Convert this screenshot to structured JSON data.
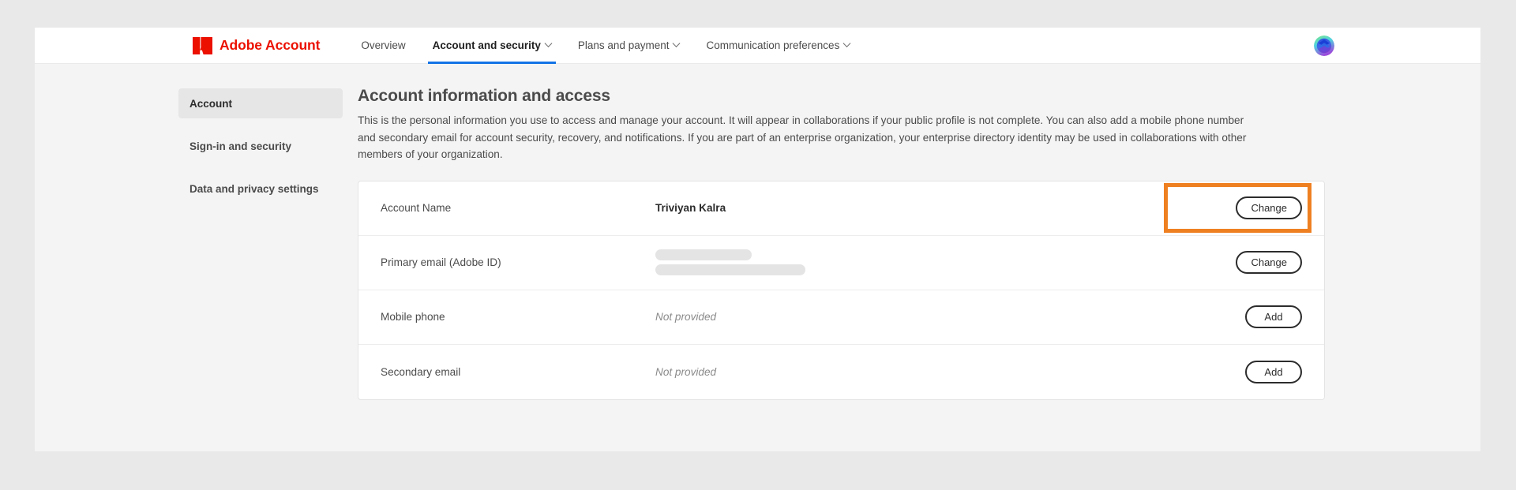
{
  "theme": {
    "page_background": "#e9e9e9",
    "frame_background": "#f4f4f4",
    "nav_background": "#ffffff",
    "brand_red": "#eb1000",
    "active_tab_underline": "#1473e6",
    "highlight_orange": "#ef8022",
    "card_background": "#ffffff",
    "sidebar_selected": "#e6e6e6",
    "redaction_gray": "#e4e4e4"
  },
  "header": {
    "brand": {
      "logo_icon": "adobe-a-logo-icon",
      "title": "Adobe Account"
    },
    "nav_items": [
      {
        "label": "Overview",
        "active": false,
        "has_chevron": false
      },
      {
        "label": "Account and security",
        "active": true,
        "has_chevron": true
      },
      {
        "label": "Plans and payment",
        "active": false,
        "has_chevron": true
      },
      {
        "label": "Communication preferences",
        "active": false,
        "has_chevron": true
      }
    ],
    "avatar": {
      "icon": "user-avatar-icon",
      "alt": "Account avatar"
    }
  },
  "sidebar": {
    "items": [
      {
        "label": "Account",
        "selected": true
      },
      {
        "label": "Sign-in and security",
        "selected": false
      },
      {
        "label": "Data and privacy settings",
        "selected": false
      }
    ]
  },
  "main": {
    "title": "Account information and access",
    "description": "This is the personal information you use to access and manage your account. It will appear in collaborations if your public profile is not complete. You can also add a mobile phone number and secondary email for account security, recovery, and notifications. If you are part of an enterprise organization, your enterprise directory identity may be used in collaborations with other members of your organization.",
    "rows": [
      {
        "label": "Account Name",
        "value": "Triviyan Kalra",
        "value_kind": "text",
        "action_label": "Change",
        "highlighted": true
      },
      {
        "label": "Primary email (Adobe ID)",
        "value": "",
        "value_kind": "redacted",
        "redaction_widths": [
          122,
          190
        ],
        "action_label": "Change",
        "highlighted": false
      },
      {
        "label": "Mobile phone",
        "value": "Not provided",
        "value_kind": "muted",
        "action_label": "Add",
        "highlighted": false
      },
      {
        "label": "Secondary email",
        "value": "Not provided",
        "value_kind": "muted",
        "action_label": "Add",
        "highlighted": false
      }
    ]
  }
}
